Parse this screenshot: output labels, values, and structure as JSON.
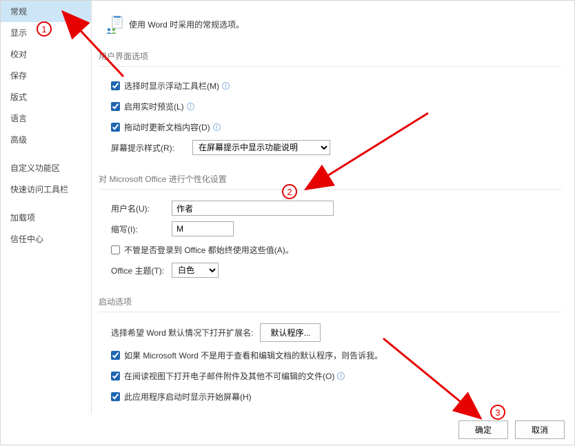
{
  "header": {
    "title": "使用 Word 时采用的常规选项。"
  },
  "sidebar": {
    "items": [
      "常规",
      "显示",
      "校对",
      "保存",
      "版式",
      "语言",
      "高级"
    ],
    "items2": [
      "自定义功能区",
      "快速访问工具栏"
    ],
    "items3": [
      "加载项",
      "信任中心"
    ],
    "active_index": 0
  },
  "sections": {
    "ui": {
      "title": "用户界面选项",
      "opt_minibar": "选择时显示浮动工具栏(M)",
      "opt_livepreview": "启用实时预览(L)",
      "opt_dragupdate": "拖动时更新文档内容(D)",
      "screentip_label": "屏幕提示样式(R):",
      "screentip_value": "在屏幕提示中显示功能说明"
    },
    "personal": {
      "title": "对 Microsoft Office 进行个性化设置",
      "username_label": "用户名(U):",
      "username_value": "作者",
      "initials_label": "缩写(I):",
      "initials_value": "M",
      "always_use": "不管是否登录到 Office 都始终使用这些值(A)。",
      "theme_label": "Office 主题(T):",
      "theme_value": "白色"
    },
    "startup": {
      "title": "启动选项",
      "ext_label": "选择希望 Word 默认情况下打开扩展名:",
      "ext_button": "默认程序...",
      "opt_default_prog": "如果 Microsoft Word 不是用于查看和编辑文档的默认程序，则告诉我。",
      "opt_open_attach": "在阅读视图下打开电子邮件附件及其他不可编辑的文件(O)",
      "opt_start_screen": "此应用程序启动时显示开始屏幕(H)"
    }
  },
  "footer": {
    "ok": "确定",
    "cancel": "取消"
  },
  "annotations": {
    "n1": "1",
    "n2": "2",
    "n3": "3"
  }
}
